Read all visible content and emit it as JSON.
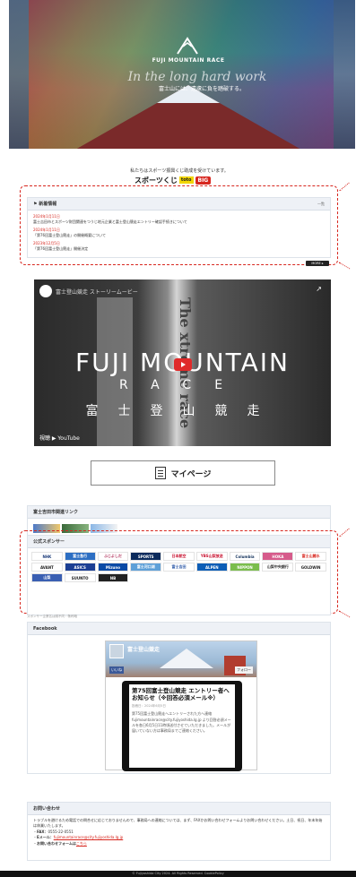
{
  "hero": {
    "brand": "FUJI MOUNTAIN RACE",
    "script_text": "In the long hard work",
    "tagline": "富士山には、遠慮に負を踏破する。"
  },
  "sponsor_note": {
    "text": "私たちはスポーツ振興くじ助成を受けています。",
    "toto": "スポーツくじ",
    "toto_badge": "toto",
    "big_badge": "BIG"
  },
  "news": {
    "heading": "新着情報",
    "more_link": "一覧",
    "items": [
      {
        "date": "2024年1月11日",
        "title": "富士吉田市とスポーツ財団関連をつうじ地元企業と富士登山競走エントリー確認手続きについて"
      },
      {
        "date": "2024年1月11日",
        "title": "「第76回富士登山競走」の開催概要について"
      },
      {
        "date": "2023年12月5日",
        "title": "「第76回富士登山競走」開催決定"
      }
    ],
    "more_button": "MORE ▸"
  },
  "video": {
    "channel_title": "富士登山競走 ストーリームービー",
    "share_label": "共有",
    "title_main": "FUJI MOUNTAIN",
    "title_race": "RACE",
    "title_jp": "富士登山競走",
    "vertical_text": "The xtreme race",
    "youtube_label": "視聴 ▶ YouTube"
  },
  "mypage": {
    "label": "マイページ"
  },
  "related": {
    "heading": "富士吉田市関連リンク"
  },
  "sponsors": {
    "heading": "公式スポンサー",
    "caption": "スポンサー企業名は順不同・敬称略",
    "list": [
      {
        "name": "NHK",
        "bg": "#ffffff",
        "fg": "#1d3c7a"
      },
      {
        "name": "富士急行",
        "bg": "#2d6fc3",
        "fg": "#ffffff"
      },
      {
        "name": "ふじよしだ",
        "bg": "#ffffff",
        "fg": "#b0305a"
      },
      {
        "name": "SPORTS",
        "bg": "#0b2a5c",
        "fg": "#ffffff"
      },
      {
        "name": "日本航空",
        "bg": "#ffffff",
        "fg": "#c8102e"
      },
      {
        "name": "YBS山梨放送",
        "bg": "#ffffff",
        "fg": "#c8102e"
      },
      {
        "name": "Columbia",
        "bg": "#ffffff",
        "fg": "#14325c"
      },
      {
        "name": "HOKA",
        "bg": "#d65b8b",
        "fg": "#ffffff"
      },
      {
        "name": "富士山麓水",
        "bg": "#ffffff",
        "fg": "#d7261e"
      },
      {
        "name": "AVANT",
        "bg": "#ffffff",
        "fg": "#222222"
      },
      {
        "name": "ASICS",
        "bg": "#1c3f94",
        "fg": "#ffffff"
      },
      {
        "name": "Mizuno",
        "bg": "#0a4aa6",
        "fg": "#ffffff"
      },
      {
        "name": "富士河口湖",
        "bg": "#5da0d8",
        "fg": "#ffffff"
      },
      {
        "name": "富士吉田",
        "bg": "#ffffff",
        "fg": "#2e5aa8"
      },
      {
        "name": "ALPEN",
        "bg": "#0c5db6",
        "fg": "#ffffff"
      },
      {
        "name": "NIPPON",
        "bg": "#7bbd4d",
        "fg": "#ffffff"
      },
      {
        "name": "山梨中央銀行",
        "bg": "#ffffff",
        "fg": "#2d2d2d"
      },
      {
        "name": "GOLDWIN",
        "bg": "#ffffff",
        "fg": "#222222"
      },
      {
        "name": "山梨",
        "bg": "#3a5fb2",
        "fg": "#ffffff"
      },
      {
        "name": "SUUNTO",
        "bg": "#ffffff",
        "fg": "#1a1a1a"
      },
      {
        "name": "NB",
        "bg": "#222222",
        "fg": "#ffffff"
      }
    ]
  },
  "facebook": {
    "heading": "Facebook",
    "page_name": "富士登山競走",
    "like_label": "いいね",
    "follow_label": "フォロー",
    "post_title": "第75回富士登山競走 エントリー者へお知らせ（※回答必須メール※）",
    "post_date": "投稿日：2024年6月5日",
    "post_body": "第75回富士登山競走へエントリーされた方へ連絡 fujimountainrace@city.fujiyoshida.lg.jp より回答必須メールを各日6月5日11時頃送付させていただきました。メールが届いていない方は事務局までご連絡ください。"
  },
  "contact": {
    "heading": "お問い合わせ",
    "intro": "トラブルを避けるため電話での問合せに応じておりませんので、事務局への連絡については、まず、FAXかお問い合わせフォームよりお問い合わせください。土日、祝日、年末年始は休業いたします。",
    "fax_label": "FAX：",
    "fax_value": "0555-22-0551",
    "mail_label": "Eメール：",
    "mail_value": "fujimountainrace@city.fujiyoshida.lg.jp",
    "form_label": "お問い合わせフォームは",
    "form_link": "こちら"
  },
  "footer": {
    "text": "© Fujiyoshida City 2024. All Rights Reserved.  CookiePolicy"
  }
}
